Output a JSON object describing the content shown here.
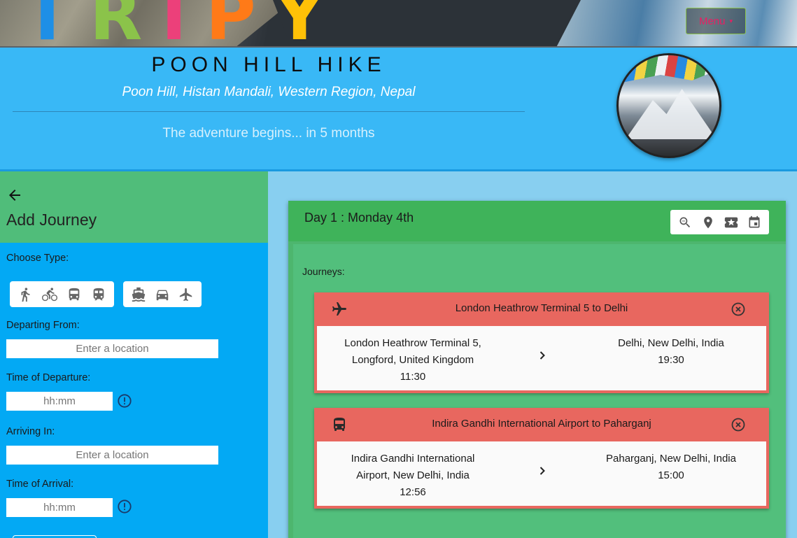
{
  "brand": {
    "logo_letters": [
      "T",
      "R",
      "I",
      "P",
      "Y"
    ]
  },
  "nav": {
    "menu_label": "Menu",
    "menu_caret": "▾"
  },
  "trip": {
    "title": "POON HILL HIKE",
    "location": "Poon Hill, Histan Mandali, Western Region, Nepal",
    "countdown": "The adventure begins... in 5 months"
  },
  "sidebar": {
    "heading": "Add Journey",
    "choose_type_label": "Choose Type:",
    "types": [
      "walk-icon",
      "bicycle-icon",
      "bus-icon",
      "train-icon",
      "ferry-icon",
      "car-icon",
      "plane-icon"
    ],
    "departing_label": "Departing From:",
    "departing_placeholder": "Enter a location",
    "departure_time_label": "Time of Departure:",
    "departure_time_placeholder": "hh:mm",
    "arriving_label": "Arriving In:",
    "arriving_placeholder": "Enter a location",
    "arrival_time_label": "Time of Arrival:",
    "arrival_time_placeholder": "hh:mm"
  },
  "day": {
    "title": "Day 1 : Monday 4th",
    "toolbar_icons": [
      "zoom-out-icon",
      "location-pin-icon",
      "ticket-icon",
      "calendar-icon"
    ],
    "journeys_label": "Journeys:",
    "journeys": [
      {
        "icon": "plane-icon",
        "title": "London Heathrow Terminal 5 to Delhi",
        "from_line1": "London Heathrow Terminal 5,",
        "from_line2": "Longford, United Kingdom",
        "from_time": "11:30",
        "to_line1": "Delhi, New Delhi, India",
        "to_time": "19:30"
      },
      {
        "icon": "bus-icon",
        "title": "Indira Gandhi International Airport to Paharganj",
        "from_line1": "Indira Gandhi International",
        "from_line2": "Airport, New Delhi, India",
        "from_time": "12:56",
        "to_line1": "Paharganj, New Delhi, India",
        "to_time": "15:00"
      }
    ]
  },
  "colors": {
    "header_blue": "#39b8f6",
    "sidebar_blue": "#03a9f4",
    "green": "#4db66e",
    "journey_red": "#e8675f",
    "menu_pink": "#e91e63"
  }
}
